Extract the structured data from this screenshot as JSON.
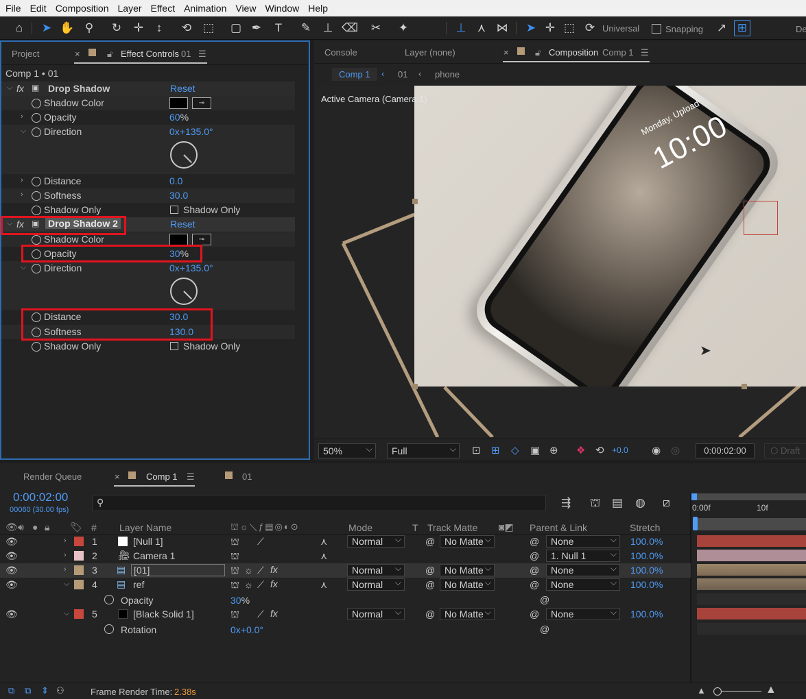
{
  "menu": [
    "File",
    "Edit",
    "Composition",
    "Layer",
    "Effect",
    "Animation",
    "View",
    "Window",
    "Help"
  ],
  "toolbar": {
    "universal_label": "Universal",
    "snapping_label": "Snapping",
    "overflow_label": "De"
  },
  "left_panel": {
    "tabs": {
      "project": "Project",
      "effect_controls_label": "Effect Controls",
      "effect_controls_target": "01"
    },
    "breadcrumb": "Comp 1 • 01",
    "effects": [
      {
        "name": "Drop Shadow",
        "reset": "Reset",
        "shadow_color_label": "Shadow Color",
        "opacity_label": "Opacity",
        "opacity_value": "60",
        "opacity_unit": "%",
        "direction_label": "Direction",
        "direction_value": "0x+135.0°",
        "distance_label": "Distance",
        "distance_value": "0.0",
        "softness_label": "Softness",
        "softness_value": "30.0",
        "shadow_only_label": "Shadow Only",
        "shadow_only_checkbox": "Shadow Only"
      },
      {
        "name": "Drop Shadow 2",
        "reset": "Reset",
        "shadow_color_label": "Shadow Color",
        "opacity_label": "Opacity",
        "opacity_value": "30",
        "opacity_unit": "%",
        "direction_label": "Direction",
        "direction_value": "0x+135.0°",
        "distance_label": "Distance",
        "distance_value": "30.0",
        "softness_label": "Softness",
        "softness_value": "130.0",
        "shadow_only_label": "Shadow Only",
        "shadow_only_checkbox": "Shadow Only"
      }
    ]
  },
  "right_panel": {
    "tabs": {
      "console": "Console",
      "layer": "Layer (none)",
      "composition_label": "Composition",
      "composition_name": "Comp 1"
    },
    "nav": [
      "Comp 1",
      "01",
      "phone"
    ],
    "viewer_label": "Active Camera (Camera 1)",
    "phone_screen": {
      "date": "Monday, Upload",
      "time": "10:00"
    },
    "footer": {
      "zoom": "50%",
      "resolution": "Full",
      "exposure": "+0.0",
      "timecode": "0:00:02:00",
      "draft": "Draft"
    }
  },
  "timeline": {
    "tabs": {
      "render_queue": "Render Queue",
      "comp": "Comp 1",
      "other": "01"
    },
    "timecode": "0:00:02:00",
    "frames_fps": "00060 (30.00 fps)",
    "search_placeholder": "",
    "headers": {
      "num": "#",
      "layer_name": "Layer Name",
      "mode": "Mode",
      "t": "T",
      "track_matte": "Track Matte",
      "parent": "Parent & Link",
      "stretch": "Stretch"
    },
    "ruler": [
      "0:00f",
      "10f"
    ],
    "layers": [
      {
        "num": "1",
        "name": "[Null 1]",
        "mode": "Normal",
        "matte": "No Matte",
        "parent": "None",
        "stretch": "100.0%",
        "color": "#c8473d",
        "bar": "#a8433b"
      },
      {
        "num": "2",
        "name": "Camera 1",
        "mode": "",
        "matte": "",
        "parent": "1. Null 1",
        "stretch": "100.0%",
        "color": "#e6c1c6",
        "bar": "#b08e98"
      },
      {
        "num": "3",
        "name": "[01]",
        "mode": "Normal",
        "matte": "No Matte",
        "parent": "None",
        "stretch": "100.0%",
        "color": "#b59a78",
        "bar": "#8f7a60"
      },
      {
        "num": "4",
        "name": "ref",
        "mode": "Normal",
        "matte": "No Matte",
        "parent": "None",
        "stretch": "100.0%",
        "color": "#b59a78",
        "bar": "#7d6c57"
      },
      {
        "num": "5",
        "name": "[Black Solid 1]",
        "mode": "Normal",
        "matte": "No Matte",
        "parent": "None",
        "stretch": "100.0%",
        "color": "#c8473d",
        "bar": "#a8433b"
      }
    ],
    "sub_opacity": {
      "label": "Opacity",
      "value": "30",
      "unit": "%"
    },
    "sub_rotation": {
      "label": "Rotation",
      "value": "0x+0.0°"
    },
    "frame_render_label": "Frame Render Time:",
    "frame_render_value": "2.38s"
  }
}
